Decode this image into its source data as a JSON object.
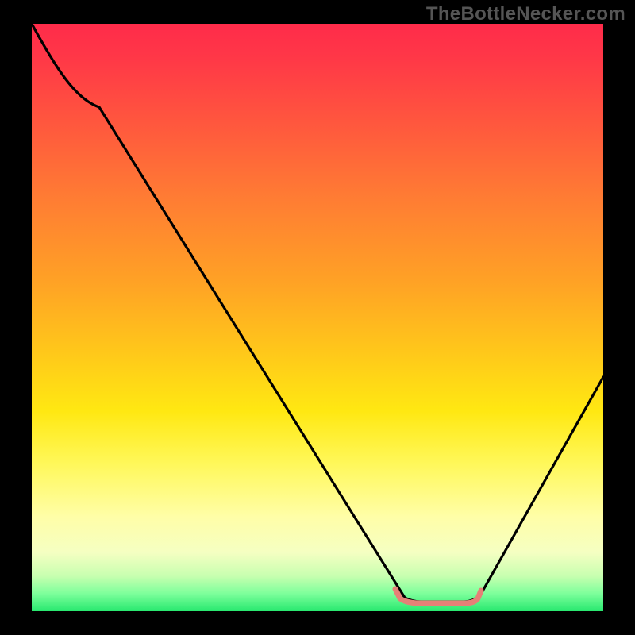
{
  "watermark": "TheBottleNecker.com",
  "chart_data": {
    "type": "line",
    "title": "",
    "xlabel": "",
    "ylabel": "",
    "xlim": [
      0,
      100
    ],
    "ylim": [
      0,
      100
    ],
    "curve_y_percent_from_top": [
      {
        "x": 0,
        "y": 0
      },
      {
        "x": 6,
        "y": 8
      },
      {
        "x": 12,
        "y": 14
      },
      {
        "x": 65,
        "y": 98
      },
      {
        "x": 76,
        "y": 98
      },
      {
        "x": 100,
        "y": 60
      }
    ],
    "constant_segment": {
      "x_start": 63,
      "x_end": 77,
      "y": 98,
      "color": "#e58077"
    },
    "notes": "Curve depicts a bottleneck-style V shape with a flat minimum segment near the bottom, highlighted in coral; gradient background runs from red (high) through yellow to green (low)."
  },
  "colors": {
    "curve": "#000000",
    "constant_segment": "#e58077",
    "background_black": "#000000",
    "watermark": "#555555"
  }
}
